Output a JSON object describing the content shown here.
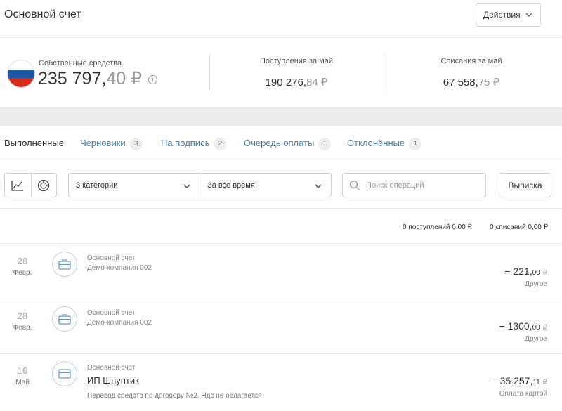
{
  "header": {
    "title": "Основной счет",
    "actions_label": "Действия"
  },
  "balance": {
    "own_funds_label": "Собственные средства",
    "own_funds_int": "235 797,",
    "own_funds_frac": "40",
    "currency": "₽",
    "info_icon_glyph": "i",
    "incoming_label": "Поступления за май",
    "incoming_int": "190 276,",
    "incoming_frac": "84",
    "outgoing_label": "Списания за май",
    "outgoing_int": "67 558,",
    "outgoing_frac": "75",
    "flag_colors": [
      "#ffffff",
      "#1c57a5",
      "#d52b1e"
    ]
  },
  "tabs": [
    {
      "label": "Выполненные",
      "count": ""
    },
    {
      "label": "Черновики",
      "count": "3"
    },
    {
      "label": "На подпись",
      "count": "2"
    },
    {
      "label": "Очередь оплаты",
      "count": "1"
    },
    {
      "label": "Отклонённые",
      "count": "1"
    }
  ],
  "filters": {
    "chart_icon": "line-chart-icon",
    "pie_icon": "pie-chart-icon",
    "categories_value": "3 категории",
    "period_value": "За все время",
    "search_placeholder": "Поиск операций",
    "export_label": "Выписка"
  },
  "summary": {
    "incoming": "0 поступлений 0,00 ₽",
    "outgoing": "0 списаний 0,00 ₽"
  },
  "operations": [
    {
      "day": "28",
      "month": "Февр.",
      "icon": "briefcase-icon",
      "account": "Основной счет",
      "counterparty": "Демо-компания 002",
      "purpose": "",
      "amount_int": "− 221,",
      "amount_frac": "00",
      "currency": "₽",
      "category": "Другое"
    },
    {
      "day": "28",
      "month": "Февр.",
      "icon": "briefcase-icon",
      "account": "Основной счет",
      "counterparty": "Демо-компания 002",
      "purpose": "",
      "amount_int": "− 1300,",
      "amount_frac": "00",
      "currency": "₽",
      "category": "Другое"
    },
    {
      "day": "16",
      "month": "Май",
      "icon": "credit-card-icon",
      "account": "Основной счет",
      "counterparty": "ИП Шпунтик",
      "purpose": "Перевод средств по договору №2. Ндс не облагается",
      "amount_int": "− 35 257,",
      "amount_frac": "11",
      "currency": "₽",
      "category": "Оплата картой"
    }
  ],
  "colors": {
    "link": "#4a7fb0",
    "icon_accent": "#6a9bc7",
    "band": "#ebebeb"
  }
}
